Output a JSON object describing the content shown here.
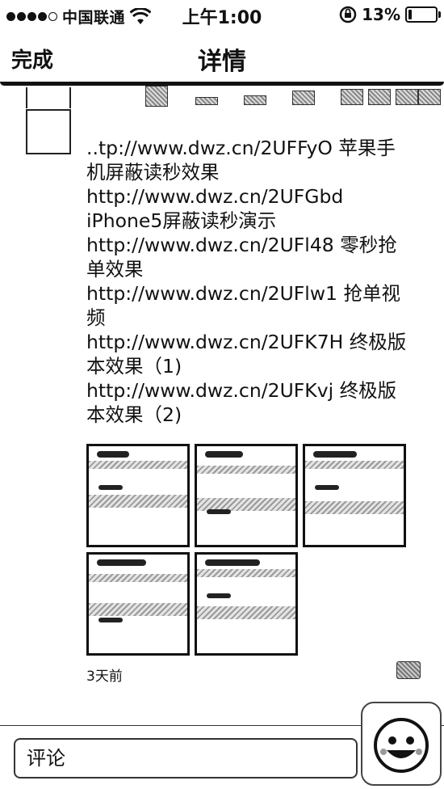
{
  "status_bar": {
    "carrier": "中国联通",
    "time": "上午1:00",
    "battery_percent": "13%",
    "battery_level": 0.13,
    "signal_bars_filled": 4,
    "signal_bars_total": 5
  },
  "nav": {
    "done_label": "完成",
    "title": "详情"
  },
  "post": {
    "lines": [
      "..tp://www.dwz.cn/2UFFyO 苹果手",
      "机屏蔽读秒效果",
      "http://www.dwz.cn/2UFGbd",
      "iPhone5屏蔽读秒演示",
      "http://www.dwz.cn/2UFl48 零秒抢",
      "单效果",
      "http://www.dwz.cn/2UFlw1 抢单视",
      "频",
      "http://www.dwz.cn/2UFK7H 终极版",
      "本效果（1)",
      "http://www.dwz.cn/2UFKvj 终极版",
      "本效果（2)"
    ],
    "time_ago": "3天前",
    "image_count": 5
  },
  "comment": {
    "placeholder": "评论"
  },
  "icons": {
    "wifi": "wifi-icon",
    "rotation_lock": "rotation-lock-icon",
    "battery": "battery-icon",
    "comment": "comment-icon",
    "emoji": "smiley-face-icon"
  }
}
